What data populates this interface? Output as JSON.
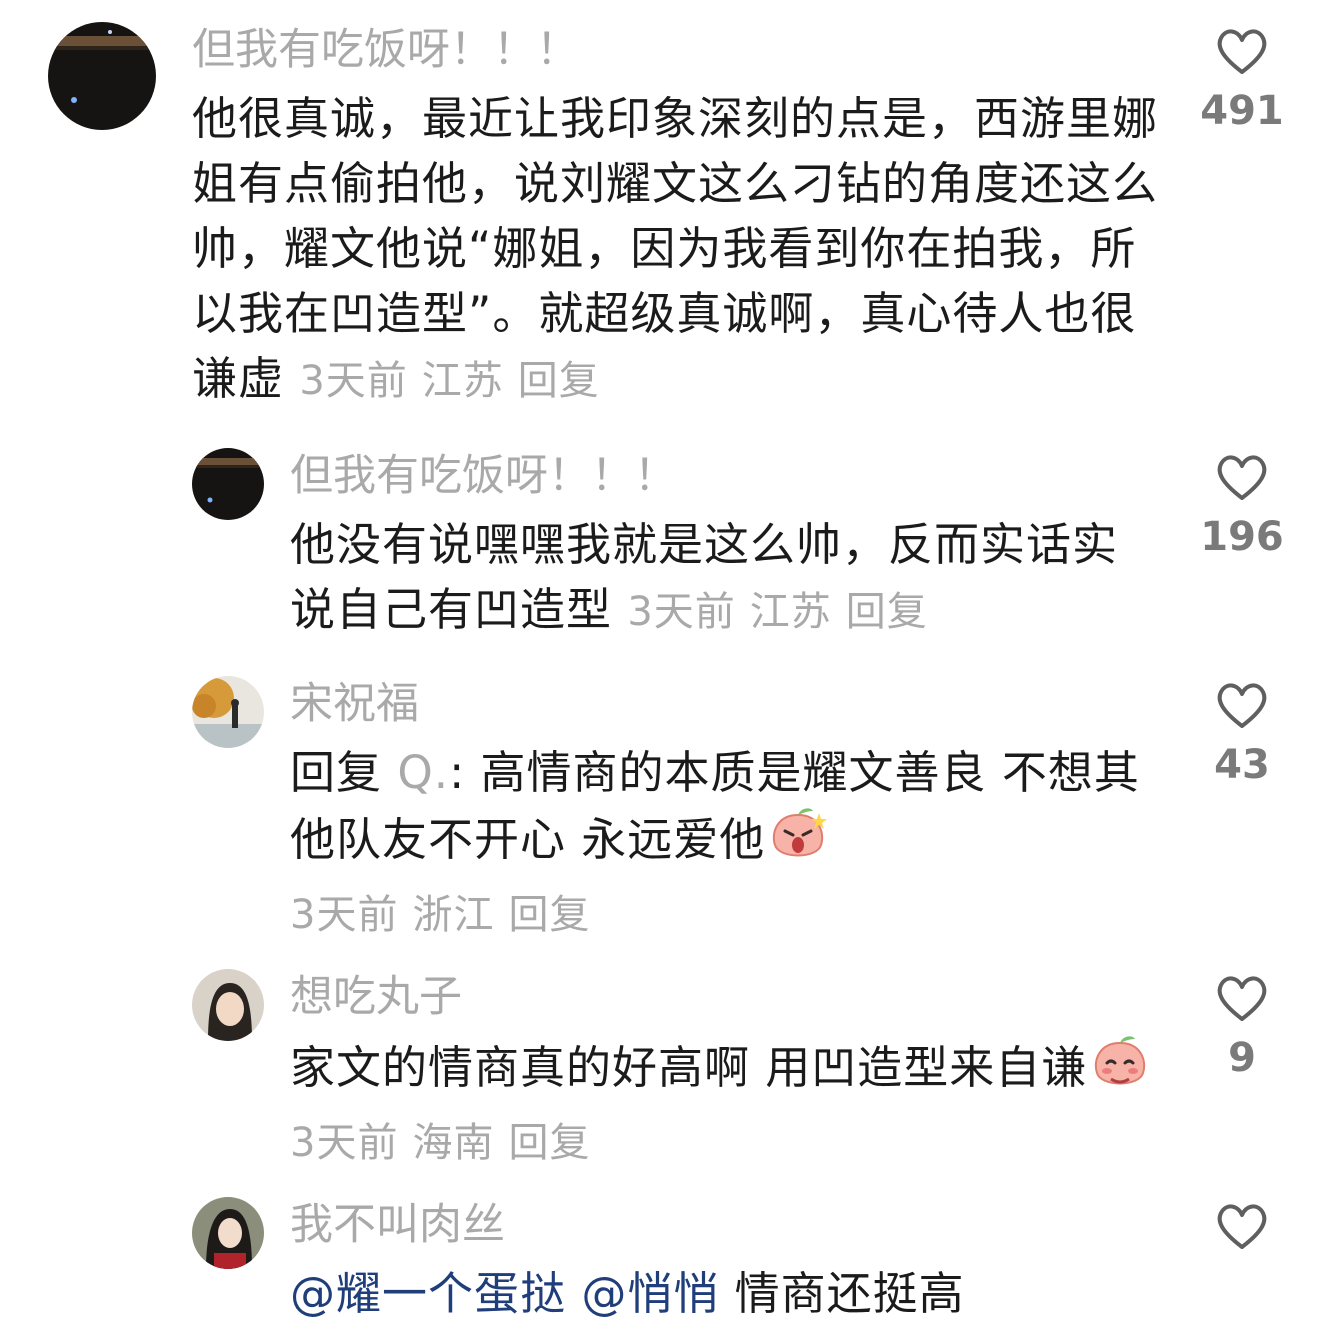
{
  "comments": [
    {
      "username": "但我有吃饭呀！！！",
      "text": "他很真诚，最近让我印象深刻的点是，西游里娜姐有点偷拍他，说刘耀文这么刁钻的角度还这么帅，耀文他说“娜姐，因为我看到你在拍我，所以我在凹造型”。就超级真诚啊，真心待人也很谦虚",
      "time": "3天前",
      "location": "江苏",
      "reply": "回复",
      "likes": "491"
    },
    {
      "username": "但我有吃饭呀！！！",
      "text": "他没有说嘿嘿我就是这么帅，反而实话实说自己有凹造型",
      "time": "3天前",
      "location": "江苏",
      "reply": "回复",
      "likes": "196"
    },
    {
      "username": "宋祝福",
      "reply_prefix": "回复",
      "reply_to": "Q.",
      "text": ": 高情商的本质是耀文善良 不想其他队友不开心 永远爱他",
      "time": "3天前",
      "location": "浙江",
      "reply": "回复",
      "likes": "43"
    },
    {
      "username": "想吃丸子",
      "text": "家文的情商真的好高啊 用凹造型来自谦",
      "time": "3天前",
      "location": "海南",
      "reply": "回复",
      "likes": "9"
    },
    {
      "username": "我不叫肉丝",
      "mention1": "@耀一个蛋挞",
      "mention2": "@悄悄",
      "text": "情商还挺高",
      "likes": ""
    }
  ],
  "icons": {
    "like": "heart-outline-icon",
    "emoji_shocked": "shocked-peach-emoji",
    "emoji_shy": "shy-peach-emoji"
  },
  "colors": {
    "username": "#a9a9a9",
    "body": "#1b1b1b",
    "mention": "#1f3e7a",
    "meta": "#a9a9a9"
  }
}
